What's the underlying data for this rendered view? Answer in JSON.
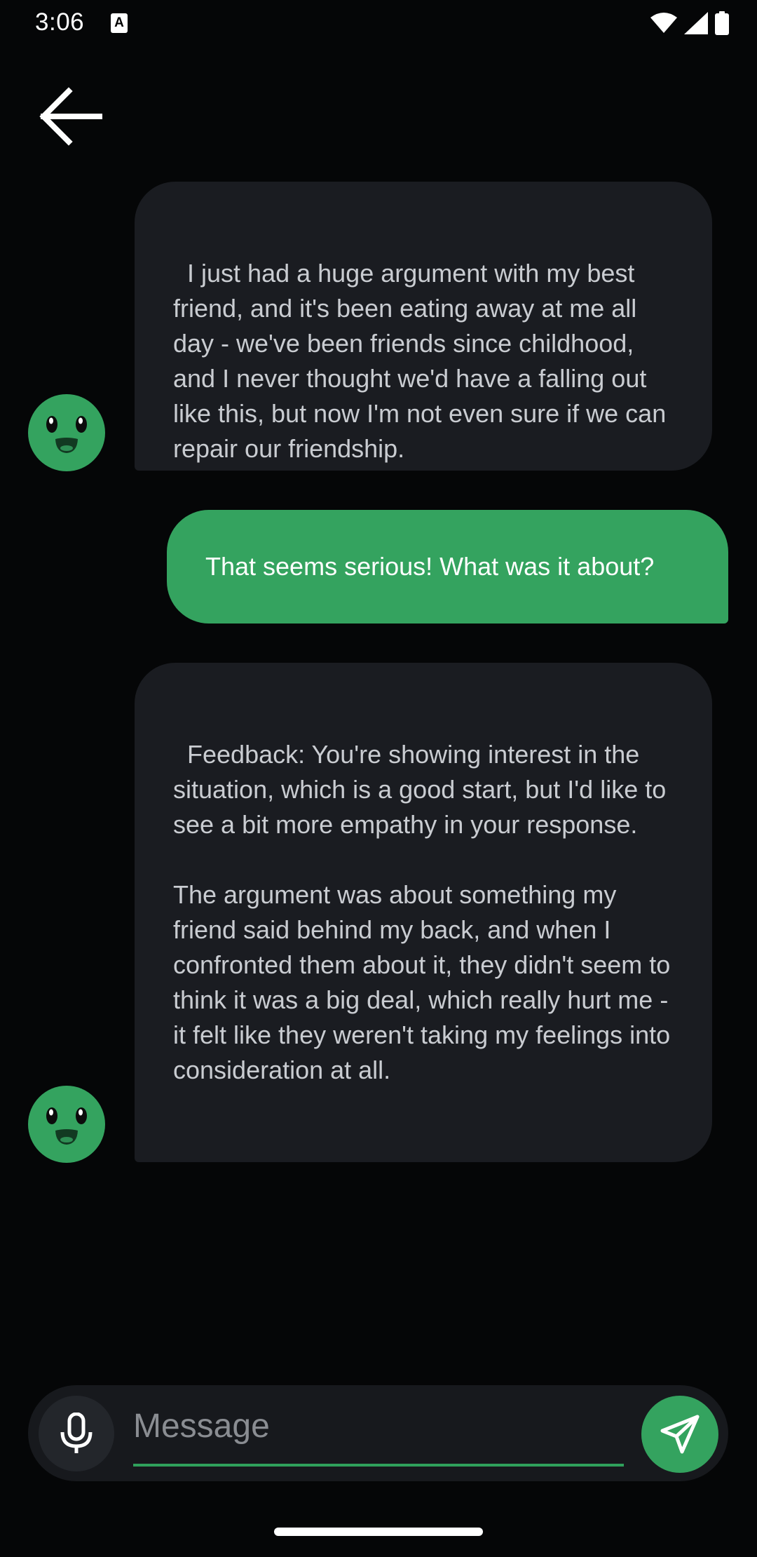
{
  "status_bar": {
    "time": "3:06",
    "notification_icon_letter": "A",
    "icons": [
      "wifi-icon",
      "signal-icon",
      "battery-icon"
    ]
  },
  "header": {
    "back_icon": "arrow-left-icon"
  },
  "messages": [
    {
      "sender": "bot",
      "text": "I just had a huge argument with my best friend, and it's been eating away at me all day - we've been friends since childhood, and I never thought we'd have a falling out like this, but now I'm not even sure if we can repair our friendship."
    },
    {
      "sender": "user",
      "text": "That seems serious! What was it about?"
    },
    {
      "sender": "bot",
      "text": "Feedback: You're showing interest in the situation, which is a good start, but I'd like to see a bit more empathy in your response.\n\nThe argument was about something my friend said behind my back, and when I confronted them about it, they didn't seem to think it was a big deal, which really hurt me - it felt like they weren't taking my feelings into consideration at all."
    }
  ],
  "composer": {
    "placeholder": "Message",
    "value": "",
    "mic_icon": "microphone-icon",
    "send_icon": "send-icon"
  },
  "colors": {
    "background": "#050607",
    "bot_bubble": "#1a1c21",
    "accent_green": "#34a35f",
    "bot_text": "#c9ccd1"
  }
}
